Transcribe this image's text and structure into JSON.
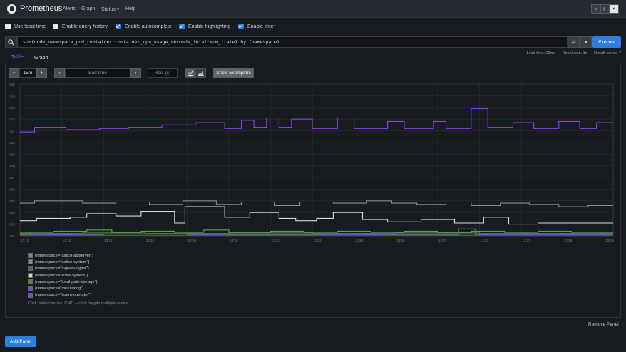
{
  "navbar": {
    "brand": "Prometheus",
    "links": [
      "Alerts",
      "Graph",
      "Status ▾",
      "Help"
    ],
    "theme_icons": [
      "sun-icon",
      "moon-icon",
      "contrast-icon"
    ]
  },
  "options": {
    "use_local_time": {
      "label": "Use local time",
      "checked": false
    },
    "query_history": {
      "label": "Enable query history",
      "checked": false
    },
    "autocomplete": {
      "label": "Enable autocomplete",
      "checked": true
    },
    "highlighting": {
      "label": "Enable highlighting",
      "checked": true
    },
    "linter": {
      "label": "Enable linter",
      "checked": true
    }
  },
  "query": {
    "text": "sum(node_namespace_pod_container:container_cpu_usage_seconds_total:sum_irate) by (namespace)",
    "execute_label": "Execute"
  },
  "stats": {
    "load_time": "Load time: 26ms",
    "resolution": "Resolution: 3s",
    "result_series": "Result series: 7"
  },
  "tabs": {
    "table": "Table",
    "graph": "Graph"
  },
  "controls": {
    "minus": "−",
    "range": "15m",
    "plus": "+",
    "prev": "‹",
    "end_time_placeholder": "End time",
    "next": "›",
    "res_placeholder": "Res. (s)",
    "show_exemplars": "Show Exemplars"
  },
  "chart_data": {
    "type": "line",
    "title": "",
    "xlabel": "",
    "ylabel": "",
    "x_ticks": [
      "13:15",
      "13:16",
      "13:17",
      "13:18",
      "13:19",
      "13:20",
      "13:21",
      "13:22",
      "13:23",
      "13:24",
      "13:25",
      "13:26",
      "13:27",
      "13:28",
      "13:29"
    ],
    "y_ticks": [
      "0.15",
      "0.14",
      "0.13",
      "0.12",
      "0.11",
      "0.10",
      "0.09",
      "0.08",
      "0.07",
      "0.06",
      "0.05",
      "0.04",
      "0.03",
      "0.02"
    ],
    "x_range": [
      0,
      14.2
    ],
    "ylim": [
      0.02,
      0.15
    ],
    "series": [
      {
        "name": "{namespace=\"tigera-operator\"}",
        "color": "#8a3ff0",
        "steps": [
          [
            0,
            0.109
          ],
          [
            0.35,
            0.113
          ],
          [
            1.1,
            0.111
          ],
          [
            1.9,
            0.112
          ],
          [
            2.6,
            0.113
          ],
          [
            3.4,
            0.115
          ],
          [
            4.2,
            0.117
          ],
          [
            4.9,
            0.112
          ],
          [
            5.3,
            0.119
          ],
          [
            5.6,
            0.113
          ],
          [
            5.9,
            0.121
          ],
          [
            6.2,
            0.113
          ],
          [
            6.5,
            0.12
          ],
          [
            7.0,
            0.112
          ],
          [
            7.6,
            0.121
          ],
          [
            8.0,
            0.112
          ],
          [
            8.8,
            0.118
          ],
          [
            9.2,
            0.112
          ],
          [
            9.9,
            0.118
          ],
          [
            10.2,
            0.112
          ],
          [
            10.8,
            0.129
          ],
          [
            11.2,
            0.113
          ],
          [
            11.8,
            0.117
          ],
          [
            12.3,
            0.112
          ],
          [
            12.9,
            0.118
          ],
          [
            13.4,
            0.112
          ],
          [
            13.8,
            0.117
          ],
          [
            14.2,
            0.117
          ]
        ]
      },
      {
        "name": "{namespace=\"calico-system\"}",
        "color": "#8c8c8c",
        "steps": [
          [
            0,
            0.048
          ],
          [
            0.35,
            0.05
          ],
          [
            1.5,
            0.048
          ],
          [
            2.3,
            0.049
          ],
          [
            3.1,
            0.047
          ],
          [
            3.9,
            0.05
          ],
          [
            4.7,
            0.047
          ],
          [
            5.3,
            0.049
          ],
          [
            6.1,
            0.046
          ],
          [
            6.7,
            0.049
          ],
          [
            7.5,
            0.048
          ],
          [
            8.3,
            0.05
          ],
          [
            8.9,
            0.048
          ],
          [
            9.5,
            0.047
          ],
          [
            10.2,
            0.049
          ],
          [
            10.8,
            0.046
          ],
          [
            11.5,
            0.048
          ],
          [
            12.2,
            0.047
          ],
          [
            12.9,
            0.045
          ],
          [
            13.6,
            0.046
          ],
          [
            14.2,
            0.046
          ]
        ]
      },
      {
        "name": "{namespace=\"kube-system\"}",
        "color": "#d8d8d8",
        "steps": [
          [
            0,
            0.033
          ],
          [
            0.4,
            0.035
          ],
          [
            1.2,
            0.036
          ],
          [
            1.6,
            0.039
          ],
          [
            2.3,
            0.037
          ],
          [
            2.9,
            0.041
          ],
          [
            3.7,
            0.031
          ],
          [
            3.95,
            0.045
          ],
          [
            4.9,
            0.036
          ],
          [
            5.5,
            0.04
          ],
          [
            6.2,
            0.035
          ],
          [
            6.6,
            0.033
          ],
          [
            7.1,
            0.035
          ],
          [
            7.5,
            0.04
          ],
          [
            8.2,
            0.034
          ],
          [
            8.8,
            0.032
          ],
          [
            9.6,
            0.034
          ],
          [
            10.4,
            0.031
          ],
          [
            11.1,
            0.036
          ],
          [
            11.7,
            0.03
          ],
          [
            12.4,
            0.031
          ],
          [
            13.0,
            0.031
          ],
          [
            14.2,
            0.031
          ]
        ]
      },
      {
        "name": "{namespace=\"calico-apiserver\"}",
        "color": "#56a64b",
        "steps": [
          [
            0,
            0.023
          ],
          [
            0.8,
            0.024
          ],
          [
            1.6,
            0.025
          ],
          [
            2.2,
            0.023
          ],
          [
            2.9,
            0.024
          ],
          [
            3.7,
            0.023
          ],
          [
            4.4,
            0.025
          ],
          [
            5.0,
            0.023
          ],
          [
            6.0,
            0.024
          ],
          [
            6.8,
            0.023
          ],
          [
            7.6,
            0.024
          ],
          [
            8.4,
            0.023
          ],
          [
            9.2,
            0.024
          ],
          [
            10.0,
            0.023
          ],
          [
            10.8,
            0.024
          ],
          [
            11.6,
            0.023
          ],
          [
            12.4,
            0.024
          ],
          [
            13.2,
            0.023
          ],
          [
            14.2,
            0.023
          ]
        ]
      },
      {
        "name": "{namespace=\"local-path-storage\"}",
        "color": "#4f8f3f",
        "steps": [
          [
            0,
            0.022
          ],
          [
            1.5,
            0.0225
          ],
          [
            3.0,
            0.022
          ],
          [
            5.0,
            0.0225
          ],
          [
            7.0,
            0.022
          ],
          [
            9.0,
            0.0225
          ],
          [
            11.0,
            0.022
          ],
          [
            14.2,
            0.022
          ]
        ]
      },
      {
        "name": "{namespace=\"monitoring\"}",
        "color": "#6a5acd",
        "steps": [
          [
            0,
            0.021
          ],
          [
            2.0,
            0.0215
          ],
          [
            4.0,
            0.021
          ],
          [
            10.5,
            0.026
          ],
          [
            10.9,
            0.021
          ],
          [
            14.2,
            0.021
          ]
        ]
      },
      {
        "name": "{namespace=\"ingress-nginx\"}",
        "color": "#5f5f5f",
        "steps": [
          [
            0,
            0.0205
          ],
          [
            14.2,
            0.0205
          ]
        ]
      }
    ],
    "legend": [
      {
        "name": "{namespace=\"calico-apiserver\"}",
        "color": "#56a64b"
      },
      {
        "name": "{namespace=\"calico-system\"}",
        "color": "#8c8c8c"
      },
      {
        "name": "{namespace=\"ingress-nginx\"}",
        "color": "#5f5f5f"
      },
      {
        "name": "{namespace=\"kube-system\"}",
        "color": "#d8d8d8"
      },
      {
        "name": "{namespace=\"local-path-storage\"}",
        "color": "#4f8f3f"
      },
      {
        "name": "{namespace=\"monitoring\"}",
        "color": "#6a5acd"
      },
      {
        "name": "{namespace=\"tigera-operator\"}",
        "color": "#8a3ff0"
      }
    ],
    "legend_hint": "Click: select series, CMD + click: toggle multiple series",
    "grid": true
  },
  "footer": {
    "remove_panel": "Remove Panel",
    "add_panel": "Add Panel"
  }
}
